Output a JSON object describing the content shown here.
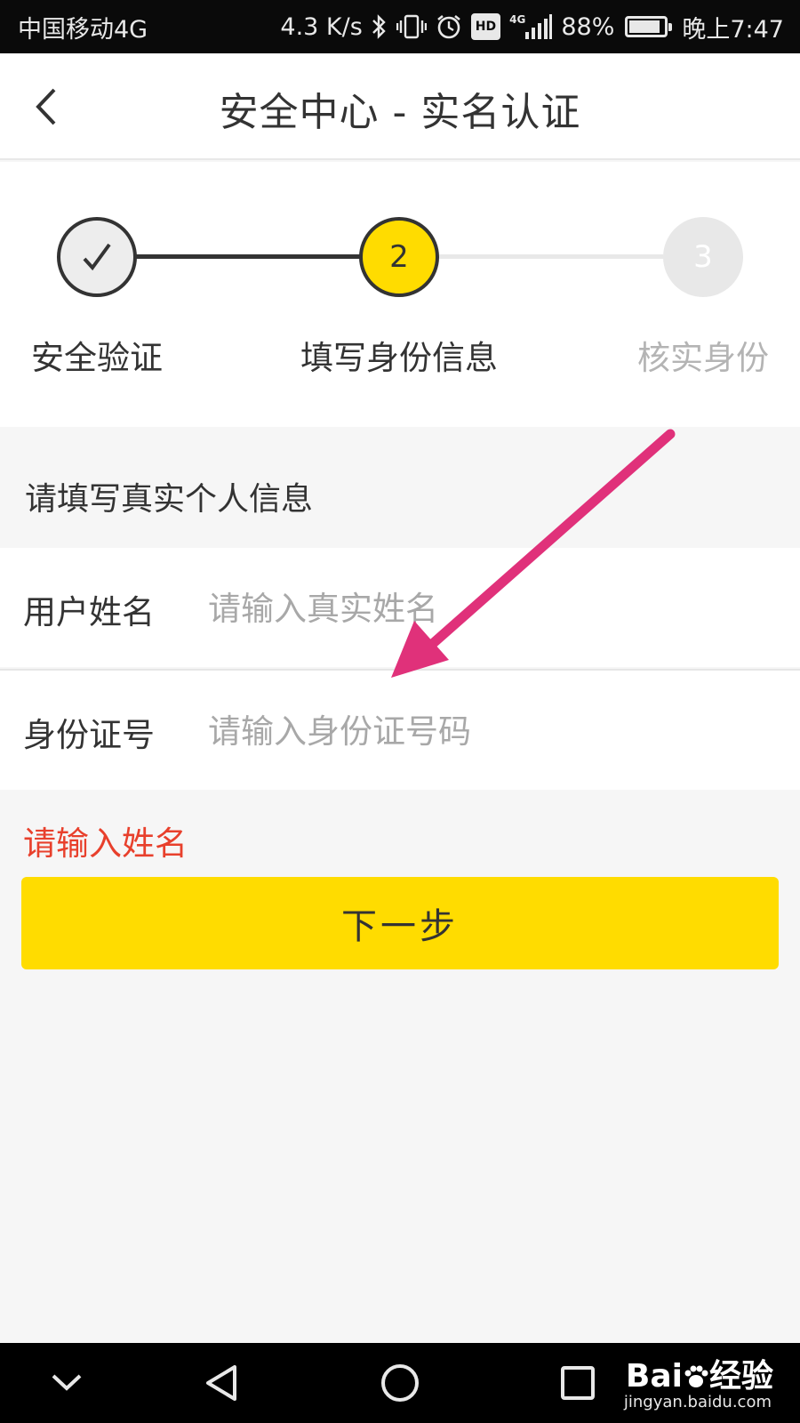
{
  "status_bar": {
    "carrier": "中国移动4G",
    "speed": "4.3 K/s",
    "hd": "HD",
    "network": "4G",
    "battery_text": "88%",
    "battery_level": 0.88,
    "time": "晚上7:47",
    "icons": [
      "bluetooth-icon",
      "vibrate-icon",
      "alarm-icon",
      "hd-icon",
      "signal-icon",
      "battery-icon"
    ]
  },
  "header": {
    "title": "安全中心 - 实名认证",
    "back_icon": "chevron-left-icon"
  },
  "stepper": {
    "steps": [
      {
        "number": "",
        "label": "安全验证",
        "state": "completed"
      },
      {
        "number": "2",
        "label": "填写身份信息",
        "state": "current"
      },
      {
        "number": "3",
        "label": "核实身份",
        "state": "pending"
      }
    ]
  },
  "form": {
    "heading": "请填写真实个人信息",
    "name_label": "用户姓名",
    "name_placeholder": "请输入真实姓名",
    "name_value": "",
    "id_label": "身份证号",
    "id_placeholder": "请输入身份证号码",
    "id_value": "",
    "error": "请输入姓名",
    "next_button": "下一步"
  },
  "nav_bar": {
    "icons": [
      "chevron-down-icon",
      "back-triangle-icon",
      "home-circle-icon",
      "recents-square-icon"
    ]
  },
  "watermark": {
    "logo_text": "Bai",
    "logo_suffix": "经验",
    "url": "jingyan.baidu.com"
  },
  "colors": {
    "accent": "#ffdc00",
    "error": "#e8402c",
    "annotation_arrow": "#e0317a",
    "pending": "#e8e8e8"
  }
}
